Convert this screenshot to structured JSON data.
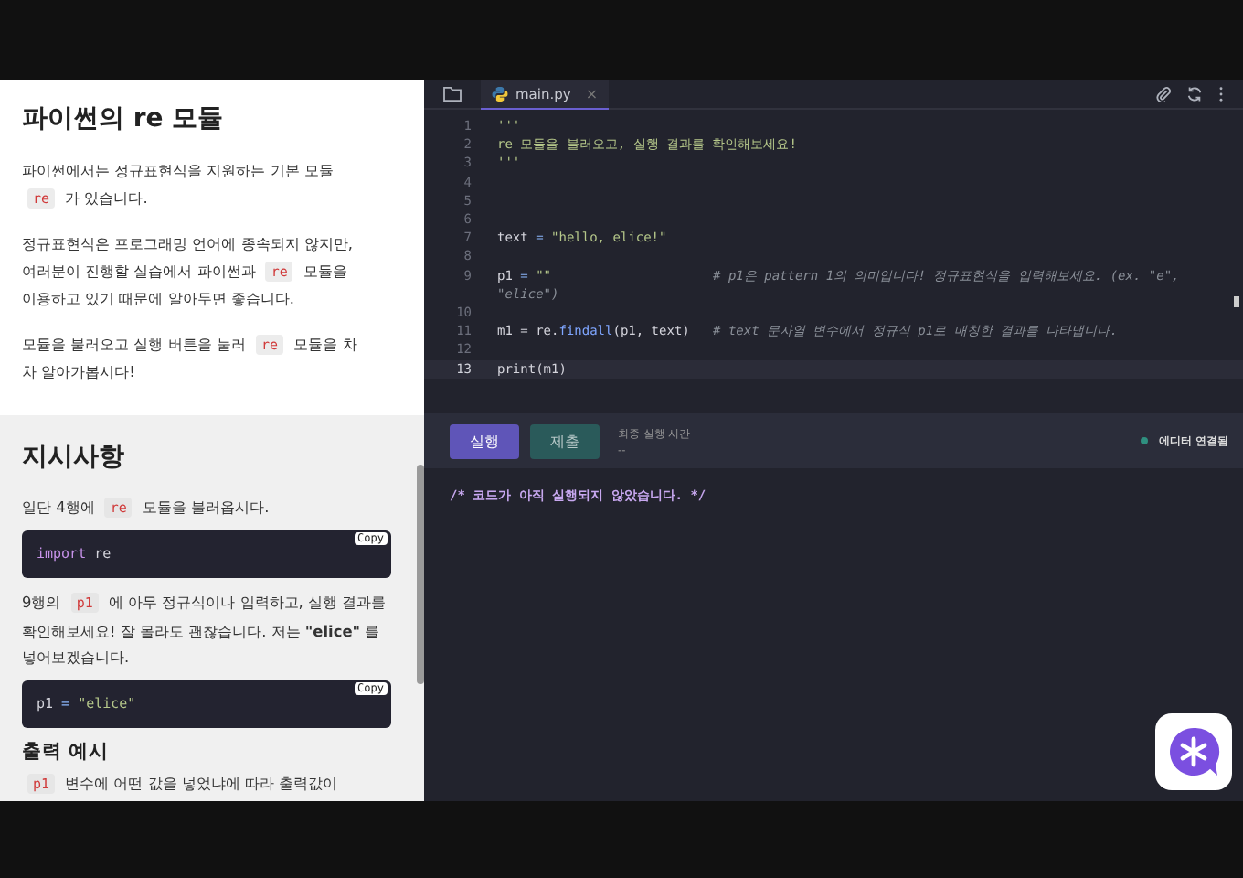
{
  "lesson": {
    "title": "파이썬의 re 모듈",
    "paragraphs": [
      [
        {
          "kind": "text",
          "text": "파이썬에서는 정규표현식을 지원하는 기본 모듈 "
        },
        {
          "kind": "code",
          "text": "re"
        },
        {
          "kind": "text",
          "text": " 가 있습니다."
        }
      ],
      [
        {
          "kind": "text",
          "text": "정규표현식은 프로그래밍 언어에 종속되지 않지만, 여러분이 진행할 실습에서 파이썬과 "
        },
        {
          "kind": "code",
          "text": "re"
        },
        {
          "kind": "text",
          "text": " 모듈을 이용하고 있기 때문에 알아두면 좋습니다."
        }
      ],
      [
        {
          "kind": "text",
          "text": "모듈을 불러오고 실행 버튼을 눌러 "
        },
        {
          "kind": "code",
          "text": "re"
        },
        {
          "kind": "text",
          "text": " 모듈을 차차 알아가봅시다!"
        }
      ]
    ]
  },
  "instructions": {
    "title": "지시사항",
    "blocks": [
      {
        "kind": "paragraph",
        "parts": [
          {
            "kind": "text",
            "text": "일단 4행에 "
          },
          {
            "kind": "code",
            "text": "re"
          },
          {
            "kind": "text",
            "text": " 모듈을 불러옵시다."
          }
        ]
      },
      {
        "kind": "codeblock",
        "copy": "Copy",
        "tokens": [
          {
            "kind": "keyword",
            "text": "import"
          },
          {
            "kind": "plain",
            "text": " re"
          }
        ]
      },
      {
        "kind": "paragraph",
        "parts": [
          {
            "kind": "text",
            "text": "9행의 "
          },
          {
            "kind": "code",
            "text": "p1"
          },
          {
            "kind": "text",
            "text": " 에 아무 정규식이나 입력하고, 실행 결과를 확인해보세요! 잘 몰라도 괜찮습니다. 저는 **\"elice\"** 를 넣어보겠습니다."
          }
        ]
      },
      {
        "kind": "codeblock",
        "copy": "Copy",
        "tokens": [
          {
            "kind": "plain",
            "text": "p1"
          },
          {
            "kind": "operator",
            "text": " = "
          },
          {
            "kind": "string",
            "text": "\"elice\""
          }
        ]
      },
      {
        "kind": "heading",
        "text": "출력 예시"
      },
      {
        "kind": "paragraph",
        "parts": [
          {
            "kind": "code",
            "text": "p1"
          },
          {
            "kind": "text",
            "text": " 변수에 어떤 값을 넣었냐에 따라 출력값이"
          }
        ]
      }
    ]
  },
  "editor": {
    "tabs": [
      {
        "label": "main.py",
        "selected": true,
        "close": "×"
      }
    ],
    "lines": [
      {
        "number": "1",
        "current": false,
        "tokens": [
          {
            "kind": "string",
            "text": "'''"
          }
        ]
      },
      {
        "number": "2",
        "current": false,
        "tokens": [
          {
            "kind": "string",
            "text": "re 모듈을 불러오고, 실행 결과를 확인해보세요!"
          }
        ]
      },
      {
        "number": "3",
        "current": false,
        "tokens": [
          {
            "kind": "string",
            "text": "'''"
          }
        ]
      },
      {
        "number": "4",
        "current": false
      },
      {
        "number": "5",
        "current": false
      },
      {
        "number": "6",
        "current": false
      },
      {
        "number": "7",
        "current": false,
        "tokens": [
          {
            "kind": "plain",
            "text": "text"
          },
          {
            "kind": "operator",
            "text": " = "
          },
          {
            "kind": "string",
            "text": "\"hello, elice!\""
          }
        ]
      },
      {
        "number": "8",
        "current": false
      },
      {
        "number": "9",
        "current": false,
        "tokens": [
          {
            "kind": "plain",
            "text": "p1"
          },
          {
            "kind": "operator",
            "text": " = "
          },
          {
            "kind": "string",
            "text": "\"\""
          },
          {
            "kind": "comment",
            "text": "                     # p1은 pattern 1의 의미입니다! 정규표현식을 입력해보세요. (ex. \"e\", \"elice\")"
          }
        ]
      },
      {
        "number": "10",
        "current": false
      },
      {
        "number": "11",
        "current": false,
        "tokens": [
          {
            "kind": "plain",
            "text": "m1 = re."
          },
          {
            "kind": "function",
            "text": "findall"
          },
          {
            "kind": "plain",
            "text": "(p1, text)"
          },
          {
            "kind": "comment",
            "text": "   # text 문자열 변수에서 정규식 p1로 매칭한 결과를 나타냅니다."
          }
        ]
      },
      {
        "number": "12",
        "current": false
      },
      {
        "number": "13",
        "current": true,
        "tokens": [
          {
            "kind": "plain",
            "text": "print(m1)"
          }
        ]
      }
    ]
  },
  "run_bar": {
    "run": "실행",
    "submit": "제출",
    "last_run_label": "최종 실행 시간",
    "last_run_value": "--",
    "status": "에디터 연결됨",
    "connected": true
  },
  "output": "/* 코드가 아직 실행되지 않았습니다. */"
}
